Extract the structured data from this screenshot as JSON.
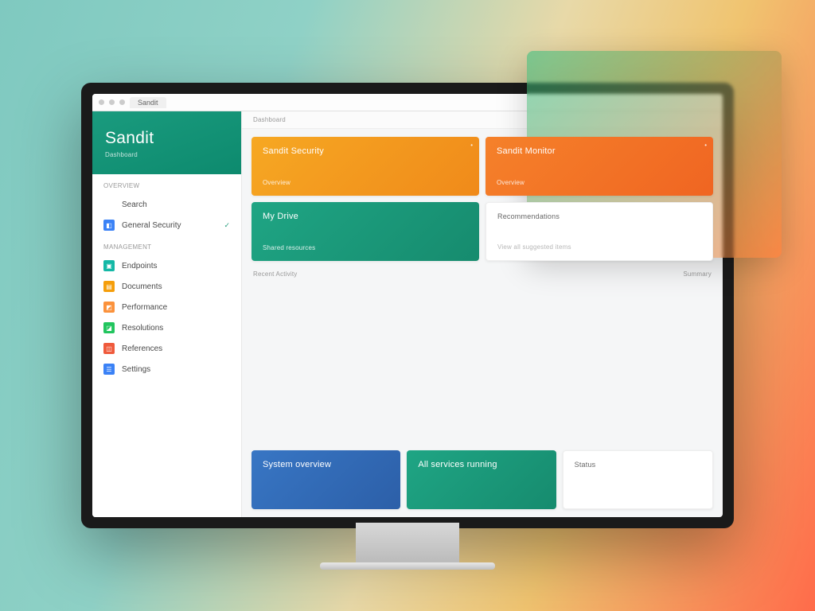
{
  "chrome": {
    "tab_label": "Sandit"
  },
  "brand": {
    "name": "Sandit",
    "subtitle": "Dashboard"
  },
  "sidebar": {
    "section_a": "Overview",
    "section_b": "Management",
    "items": [
      {
        "label": "Search",
        "icon_class": "ico-play",
        "glyph": "▶",
        "checked": false
      },
      {
        "label": "General Security",
        "icon_class": "ico-blue",
        "glyph": "◧",
        "checked": true
      },
      {
        "label": "Endpoints",
        "icon_class": "ico-teal",
        "glyph": "▣",
        "checked": false
      },
      {
        "label": "Documents",
        "icon_class": "ico-amber",
        "glyph": "▤",
        "checked": false
      },
      {
        "label": "Performance",
        "icon_class": "ico-orange",
        "glyph": "◩",
        "checked": false
      },
      {
        "label": "Resolutions",
        "icon_class": "ico-green",
        "glyph": "◪",
        "checked": false
      },
      {
        "label": "References",
        "icon_class": "ico-red",
        "glyph": "◫",
        "checked": false
      },
      {
        "label": "Settings",
        "icon_class": "ico-blue",
        "glyph": "☰",
        "checked": false
      }
    ]
  },
  "page": {
    "heading": "Dashboard"
  },
  "cards": {
    "a": {
      "title": "Sandit Security",
      "meta": "Overview",
      "corner": "•"
    },
    "b": {
      "title": "Sandit Monitor",
      "meta": "Overview",
      "corner": "•"
    },
    "c": {
      "title": "My Drive",
      "meta": "Shared resources"
    },
    "d": {
      "title": "Recommendations",
      "meta": "View all suggested items"
    },
    "e_head_l": "Recent Activity",
    "e_head_r": "Summary",
    "e": {
      "title": "System overview",
      "meta": ""
    },
    "f": {
      "title": "All services running",
      "meta": ""
    },
    "g": {
      "title": "Status",
      "meta": ""
    }
  }
}
